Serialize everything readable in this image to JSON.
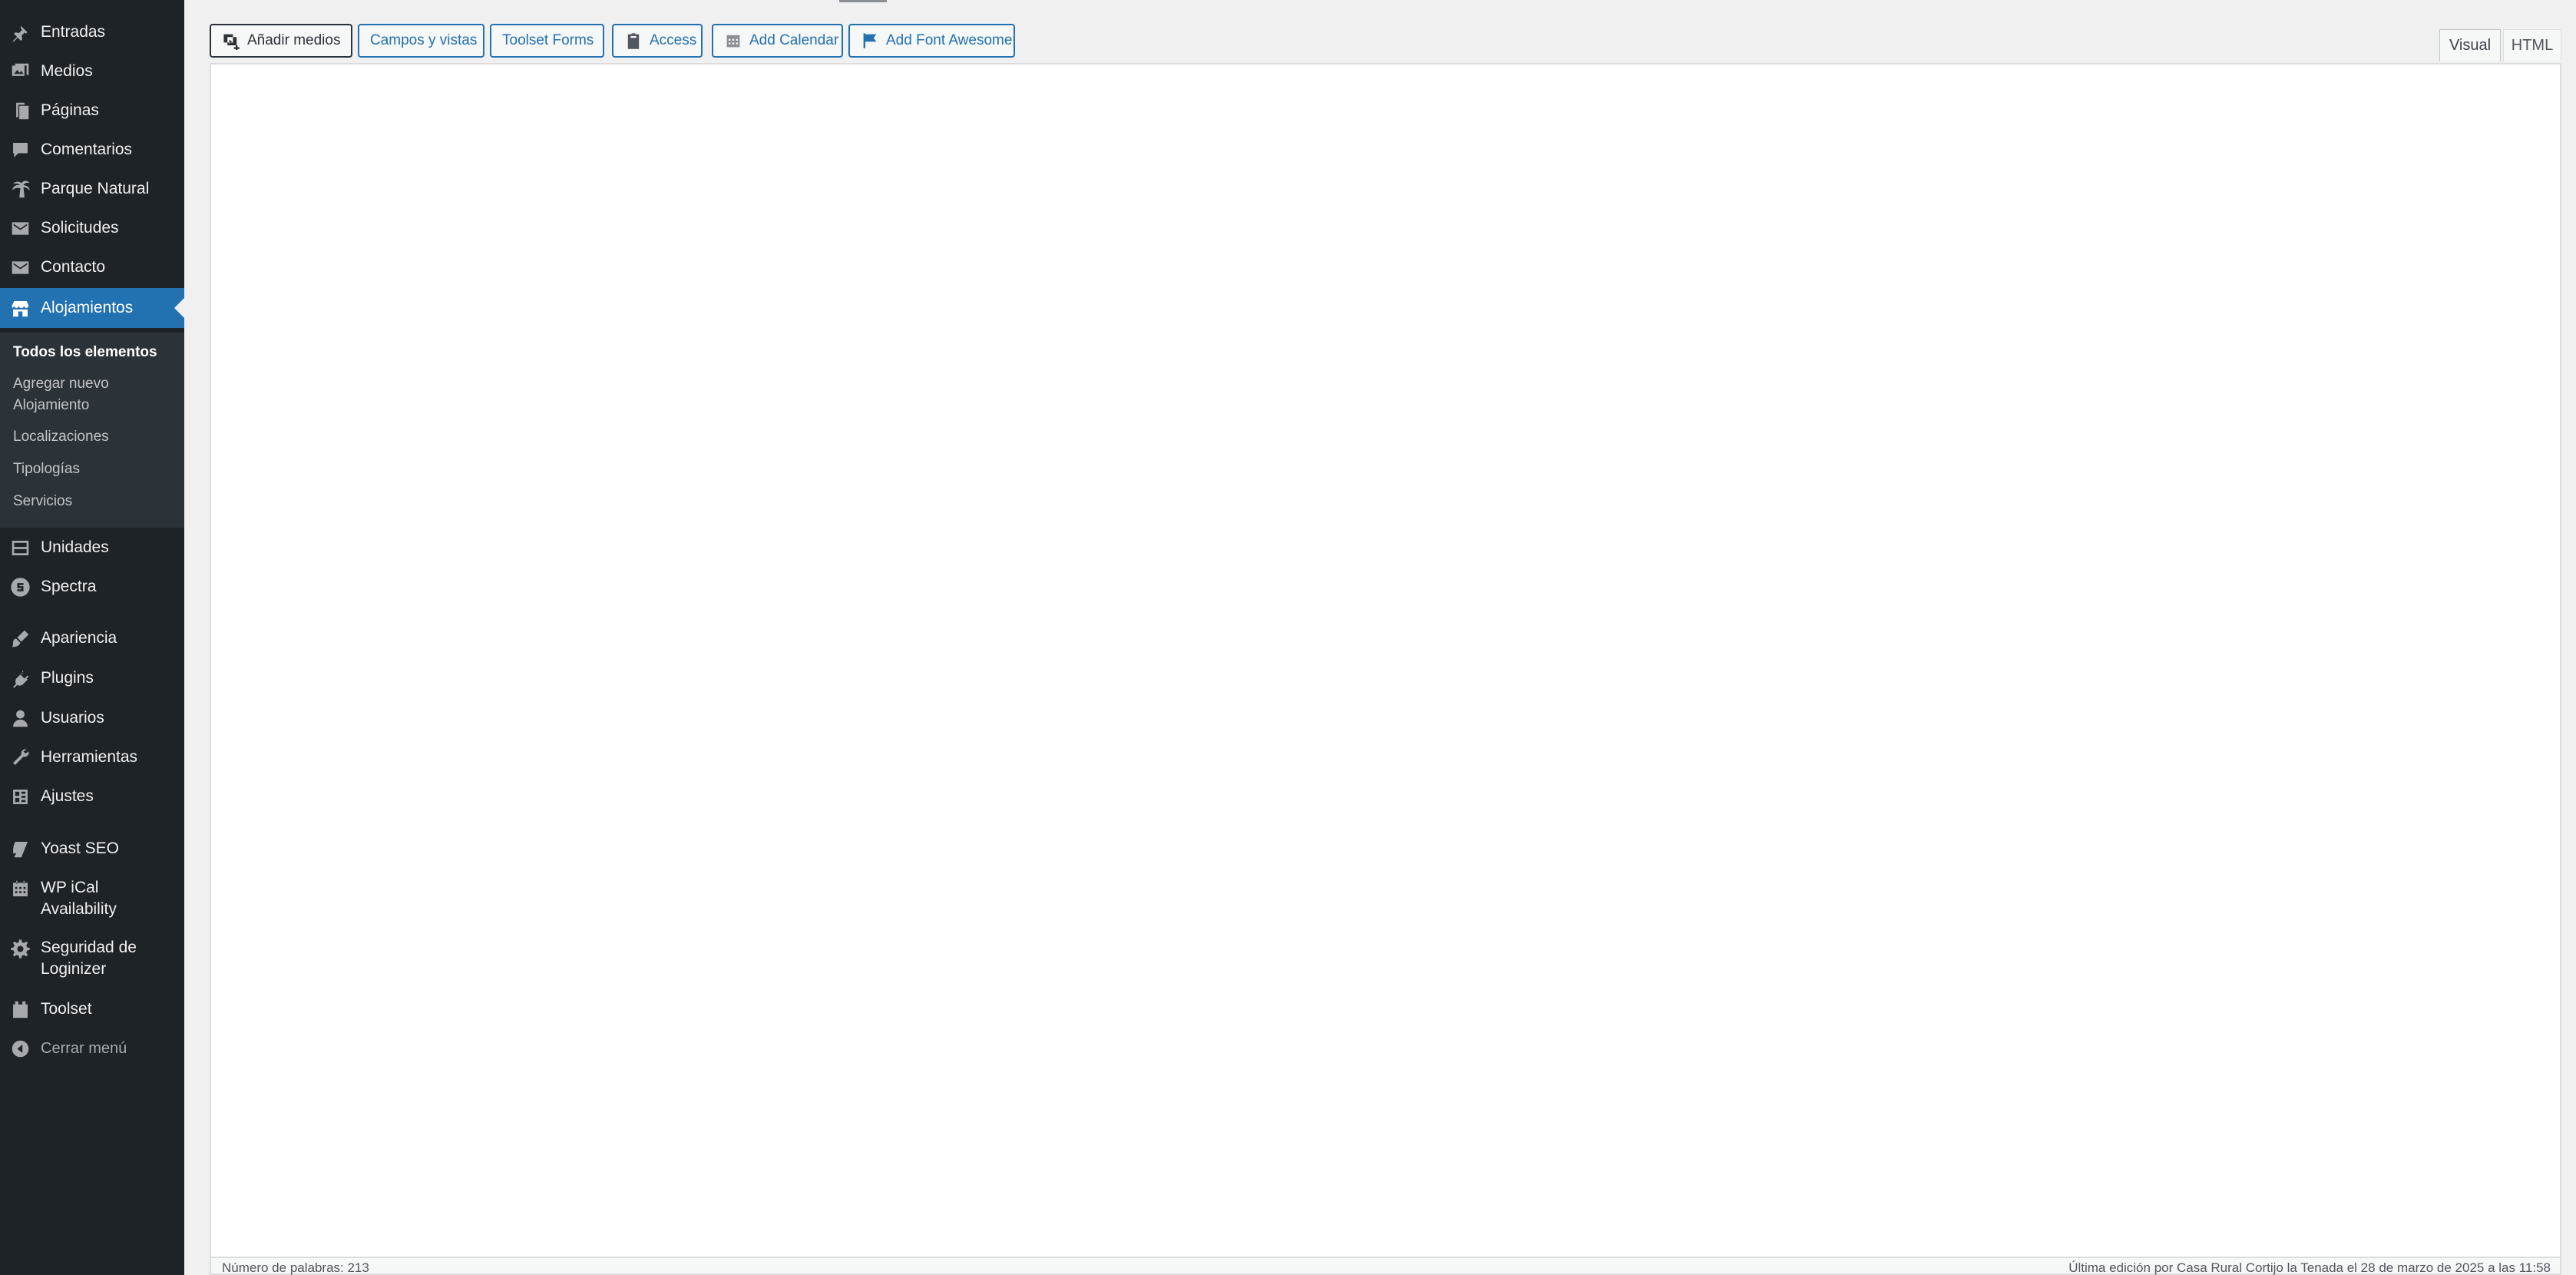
{
  "sidebar": {
    "items": [
      {
        "label": "Entradas",
        "icon": "pin-icon"
      },
      {
        "label": "Medios",
        "icon": "media-icon"
      },
      {
        "label": "Páginas",
        "icon": "pages-icon"
      },
      {
        "label": "Comentarios",
        "icon": "comment-icon"
      },
      {
        "label": "Parque Natural",
        "icon": "palm-tree-icon"
      },
      {
        "label": "Solicitudes",
        "icon": "envelope-icon"
      },
      {
        "label": "Contacto",
        "icon": "envelope-icon"
      },
      {
        "label": "Alojamientos",
        "icon": "store-icon"
      },
      {
        "label": "Unidades",
        "icon": "layout-icon"
      },
      {
        "label": "Spectra",
        "icon": "spectra-logo-icon"
      },
      {
        "label": "Apariencia",
        "icon": "brush-icon"
      },
      {
        "label": "Plugins",
        "icon": "plugin-icon"
      },
      {
        "label": "Usuarios",
        "icon": "user-icon"
      },
      {
        "label": "Herramientas",
        "icon": "wrench-icon"
      },
      {
        "label": "Ajustes",
        "icon": "settings-icon"
      },
      {
        "label": "Yoast SEO",
        "icon": "yoast-icon"
      },
      {
        "label_line1": "WP iCal",
        "label_line2": "Availability",
        "icon": "calendar-icon"
      },
      {
        "label_line1": "Seguridad de",
        "label_line2": "Loginizer",
        "icon": "gear-icon"
      },
      {
        "label": "Toolset",
        "icon": "toolset-icon"
      },
      {
        "label": "Cerrar menú",
        "icon": "collapse-icon"
      }
    ],
    "submenu": {
      "items": [
        {
          "label": "Todos los elementos"
        },
        {
          "label_line1": "Agregar nuevo",
          "label_line2": "Alojamiento"
        },
        {
          "label": "Localizaciones"
        },
        {
          "label": "Tipologías"
        },
        {
          "label": "Servicios"
        }
      ]
    }
  },
  "toolbar": {
    "add_media": "Añadir medios",
    "views": "Campos y vistas",
    "toolset_forms": "Toolset Forms",
    "access": "Access",
    "add_calendar": "Add Calendar",
    "add_font_awesome": "Add Font Awesome"
  },
  "editor_tabs": {
    "visual": "Visual",
    "html": "HTML"
  },
  "status_bar": {
    "word_count": "Número de palabras: 213",
    "last_edit": "Última edición por Casa Rural Cortijo la Tenada el 28 de marzo de 2025 a las 11:58"
  },
  "colors": {
    "sidebar_bg": "#1d2327",
    "submenu_bg": "#2c3338",
    "accent": "#2271b1"
  }
}
